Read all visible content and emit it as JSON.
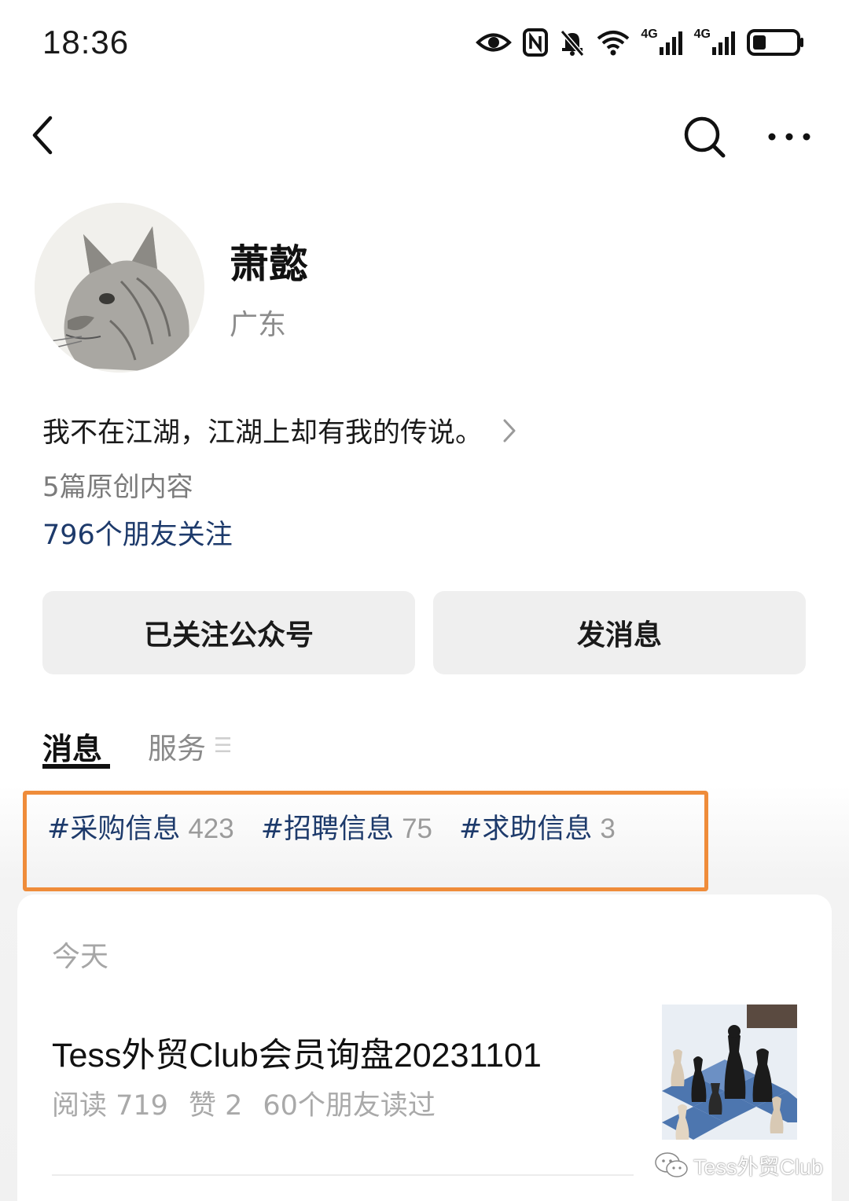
{
  "status_bar": {
    "time": "18:36",
    "icons": [
      "eye-comfort-icon",
      "nfc-icon",
      "mute-bell-icon",
      "wifi-icon",
      "signal-4g-icon",
      "signal-4g-icon",
      "battery-icon"
    ],
    "network_label_1": "4G",
    "network_label_2": "4G",
    "battery_level": 0.3
  },
  "nav": {
    "icons": [
      "back-icon",
      "search-icon",
      "more-icon"
    ]
  },
  "profile": {
    "name": "萧懿",
    "region": "广东",
    "bio": "我不在江湖，江湖上却有我的传说。",
    "original_count": "5篇原创内容",
    "friends_following": "796个朋友关注"
  },
  "actions": {
    "follow_label": "已关注公众号",
    "message_label": "发消息"
  },
  "tabs": [
    {
      "label": "消息",
      "active": true
    },
    {
      "label": "服务",
      "active": false
    }
  ],
  "tags": [
    {
      "label": "#采购信息",
      "count": "423"
    },
    {
      "label": "#招聘信息",
      "count": "75"
    },
    {
      "label": "#求助信息",
      "count": "3"
    }
  ],
  "feed": {
    "date_header": "今天",
    "article": {
      "title": "Tess外贸Club会员询盘20231101",
      "reads": "阅读 719",
      "likes": "赞 2",
      "friends_read": "60个朋友读过"
    }
  },
  "watermark": "Tess外贸Club",
  "colors": {
    "link_blue": "#1d3a6b",
    "highlight_orange": "#ef8c3a",
    "button_gray": "#efefef"
  }
}
